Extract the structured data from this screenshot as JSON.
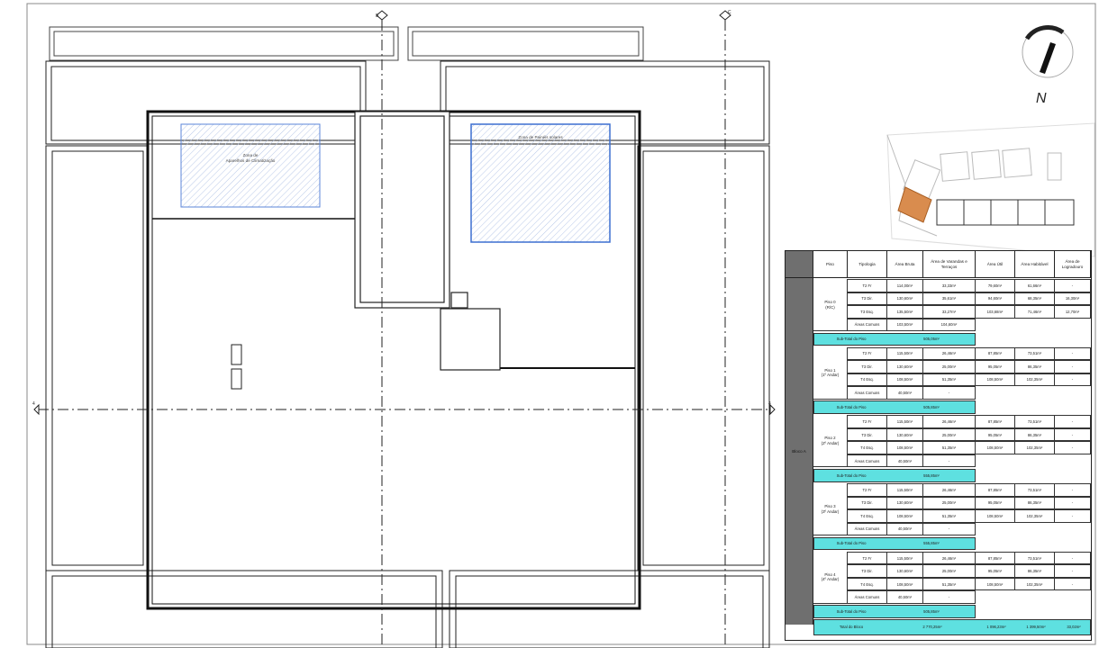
{
  "drawing": {
    "north_label": "N",
    "axis_labels": {
      "top_left": "B",
      "top_right": "C",
      "left": "4",
      "right": "4"
    },
    "zone_aircon_label": "Zona de\nAparelhos de Climatização",
    "zone_solar_label": "Zona de Painéis solares"
  },
  "table": {
    "headers": [
      "Piso",
      "Tipologia",
      "Área Bruta",
      "Área de Varandas e Terraços",
      "Área Útil",
      "Área Habitável",
      "Área de Logradouro"
    ],
    "block_label": "Bloco A",
    "floors": [
      {
        "name": "Piso 0\n(R/C)",
        "rows": [
          [
            "T2 Fr",
            "114,00m²",
            "33,33m²",
            "79,60m²",
            "61,66m²",
            "-"
          ],
          [
            "T3 Dir.",
            "130,60m²",
            "35,61m²",
            "94,60m²",
            "68,35m²",
            "16,30m²"
          ],
          [
            "T3 Esq.",
            "135,50m²",
            "33,27m²",
            "103,68m²",
            "71,46m²",
            "12,70m²"
          ]
        ],
        "common": [
          "Áreas Comuns",
          "103,50m²",
          "104,60m²"
        ],
        "subtotal": [
          "Sub-Total do Piso",
          "505,05m²"
        ]
      },
      {
        "name": "Piso 1\n(1º Andar)",
        "rows": [
          [
            "T2 Fr",
            "115,50m²",
            "26,46m²",
            "87,85m²",
            "73,51m²",
            "-"
          ],
          [
            "T3 Dir.",
            "130,60m²",
            "25,00m²",
            "95,05m²",
            "86,35m²",
            "-"
          ],
          [
            "T4 Esq.",
            "108,50m²",
            "51,35m²",
            "108,50m²",
            "102,35m²",
            "-"
          ]
        ],
        "common": [
          "Áreas Comuns",
          "40,50m²",
          "-"
        ],
        "subtotal": [
          "Sub-Total do Piso",
          "505,85m²"
        ]
      },
      {
        "name": "Piso 2\n(2º Andar)",
        "rows": [
          [
            "T2 Fr",
            "115,50m²",
            "26,46m²",
            "87,85m²",
            "73,51m²",
            "-"
          ],
          [
            "T3 Dir.",
            "130,60m²",
            "25,00m²",
            "95,05m²",
            "86,35m²",
            "-"
          ],
          [
            "T4 Esq.",
            "108,50m²",
            "51,35m²",
            "108,50m²",
            "102,35m²",
            "-"
          ]
        ],
        "common": [
          "Áreas Comuns",
          "40,50m²",
          "-"
        ],
        "subtotal": [
          "Sub-Total do Piso",
          "555,85m²"
        ]
      },
      {
        "name": "Piso 3\n(3º Andar)",
        "rows": [
          [
            "T2 Fr",
            "115,50m²",
            "26,46m²",
            "87,85m²",
            "73,51m²",
            "-"
          ],
          [
            "T3 Dir.",
            "130,60m²",
            "25,00m²",
            "95,05m²",
            "86,35m²",
            "-"
          ],
          [
            "T4 Esq.",
            "108,50m²",
            "51,35m²",
            "108,50m²",
            "102,35m²",
            "-"
          ]
        ],
        "common": [
          "Áreas Comuns",
          "40,50m²",
          "-"
        ],
        "subtotal": [
          "Sub-Total do Piso",
          "555,85m²"
        ]
      },
      {
        "name": "Piso 4\n(4º Andar)",
        "rows": [
          [
            "T2 Fr",
            "115,50m²",
            "26,46m²",
            "87,85m²",
            "73,51m²",
            "-"
          ],
          [
            "T3 Dir.",
            "130,60m²",
            "25,00m²",
            "95,05m²",
            "86,35m²",
            "-"
          ],
          [
            "T4 Esq.",
            "108,50m²",
            "51,35m²",
            "108,50m²",
            "102,35m²",
            "-"
          ]
        ],
        "common": [
          "Áreas Comuns",
          "40,50m²",
          "-"
        ],
        "subtotal": [
          "Sub-Total do Piso",
          "505,85m²"
        ]
      }
    ],
    "total": [
      "Total do Bloco",
      "2 770,25m²",
      "1 096,23m²",
      "1 399,50m²",
      "33,02m²"
    ]
  }
}
